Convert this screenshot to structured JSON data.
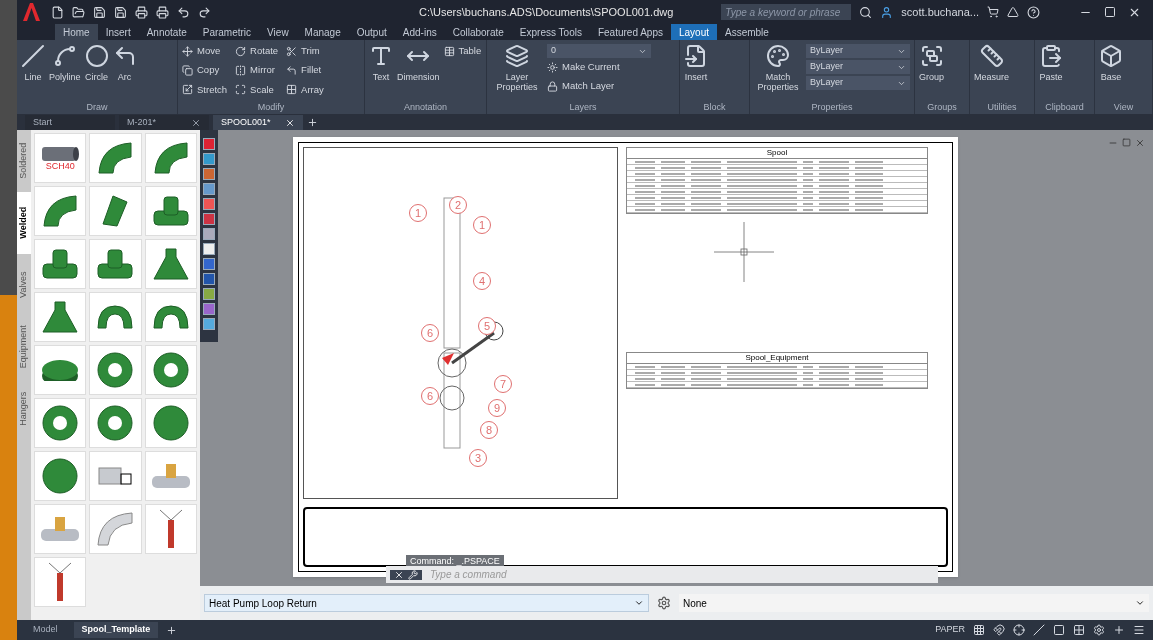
{
  "title_bar": {
    "path": "C:\\Users\\buchans.ADS\\Documents\\SPOOL001.dwg",
    "search": {
      "placeholder": "Type a keyword or phrase"
    },
    "user": "scott.buchana..."
  },
  "ribbon_tabs": [
    {
      "label": "Home",
      "selected": true,
      "kind": "normal"
    },
    {
      "label": "Insert",
      "selected": false,
      "kind": "normal"
    },
    {
      "label": "Annotate",
      "selected": false,
      "kind": "normal"
    },
    {
      "label": "Parametric",
      "selected": false,
      "kind": "normal"
    },
    {
      "label": "View",
      "selected": false,
      "kind": "normal"
    },
    {
      "label": "Manage",
      "selected": false,
      "kind": "normal"
    },
    {
      "label": "Output",
      "selected": false,
      "kind": "normal"
    },
    {
      "label": "Add-ins",
      "selected": false,
      "kind": "normal"
    },
    {
      "label": "Collaborate",
      "selected": false,
      "kind": "normal"
    },
    {
      "label": "Express Tools",
      "selected": false,
      "kind": "normal"
    },
    {
      "label": "Featured Apps",
      "selected": false,
      "kind": "normal"
    },
    {
      "label": "Layout",
      "selected": false,
      "kind": "contextual"
    },
    {
      "label": "Assemble",
      "selected": false,
      "kind": "normal"
    }
  ],
  "ribbon_panels": [
    {
      "title": "Draw",
      "large": [
        "Line",
        "Polyline",
        "Circle",
        "Arc"
      ]
    },
    {
      "title": "Modify",
      "small": [
        "Move",
        "Copy",
        "Stretch",
        "Rotate",
        "Mirror",
        "Scale",
        "Trim",
        "Fillet",
        "Array"
      ]
    },
    {
      "title": "Annotation",
      "large": [
        "Text",
        "Dimension"
      ],
      "small": [
        "Table"
      ]
    },
    {
      "title": "Layers",
      "large": [
        "Layer Properties"
      ],
      "small": [
        "Make Current",
        "Match Layer"
      ],
      "fields": [
        "0"
      ]
    },
    {
      "title": "Block",
      "large": [
        "Insert"
      ]
    },
    {
      "title": "Properties",
      "large": [
        "Match Properties"
      ],
      "fields": [
        "ByLayer",
        "ByLayer",
        "ByLayer"
      ]
    },
    {
      "title": "Groups",
      "large": [
        "Group"
      ]
    },
    {
      "title": "Utilities",
      "large": [
        "Measure"
      ]
    },
    {
      "title": "Clipboard",
      "large": [
        "Paste"
      ]
    },
    {
      "title": "View",
      "large": [
        "Base"
      ]
    }
  ],
  "file_tabs": [
    {
      "label": "Start",
      "selected": false,
      "closable": false
    },
    {
      "label": "M-201*",
      "selected": false,
      "closable": true
    },
    {
      "label": "SPOOL001*",
      "selected": true,
      "closable": true
    }
  ],
  "palette": {
    "tabs": [
      {
        "label": "Soldered",
        "selected": false
      },
      {
        "label": "Welded",
        "selected": true
      },
      {
        "label": "Valves",
        "selected": false
      },
      {
        "label": "Equipment",
        "selected": false
      },
      {
        "label": "Hangers",
        "selected": false
      }
    ],
    "items": [
      {
        "kind": "pipe",
        "label": "SCH40"
      },
      {
        "kind": "elbow"
      },
      {
        "kind": "elbow"
      },
      {
        "kind": "elbow"
      },
      {
        "kind": "elbow45"
      },
      {
        "kind": "tee"
      },
      {
        "kind": "tee"
      },
      {
        "kind": "tee"
      },
      {
        "kind": "reducer"
      },
      {
        "kind": "reducer"
      },
      {
        "kind": "return"
      },
      {
        "kind": "return"
      },
      {
        "kind": "cap"
      },
      {
        "kind": "flange"
      },
      {
        "kind": "flange"
      },
      {
        "kind": "flange"
      },
      {
        "kind": "flange"
      },
      {
        "kind": "blind"
      },
      {
        "kind": "blind"
      },
      {
        "kind": "stub"
      },
      {
        "kind": "branch"
      },
      {
        "kind": "branch"
      },
      {
        "kind": "bend"
      },
      {
        "kind": "hanger"
      },
      {
        "kind": "hanger"
      }
    ]
  },
  "drawing": {
    "callouts": [
      "1",
      "2",
      "1",
      "4",
      "5",
      "6",
      "6",
      "7",
      "9",
      "8",
      "3"
    ],
    "tables": [
      {
        "title": "Spool"
      },
      {
        "title": "Spool_Equipment"
      }
    ],
    "command_history": "Command:  _.PSPACE",
    "command_placeholder": "Type a command"
  },
  "properties_bar": {
    "spool": "Heat Pump Loop Return",
    "value": "None"
  },
  "layout_tabs": [
    {
      "label": "Model",
      "selected": false
    },
    {
      "label": "Spool_Template",
      "selected": true
    }
  ],
  "status_bar": {
    "space": "PAPER"
  }
}
